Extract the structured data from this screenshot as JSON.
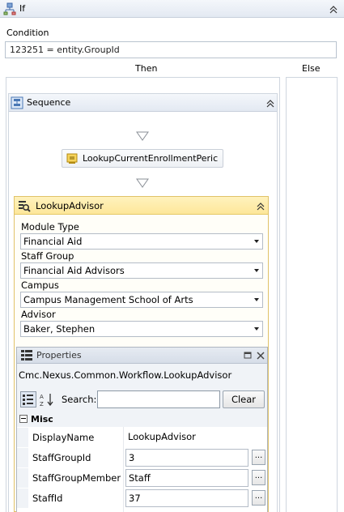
{
  "if_activity": {
    "title": "If"
  },
  "condition": {
    "label": "Condition",
    "value": "123251 = entity.GroupId"
  },
  "branches": {
    "then_label": "Then",
    "else_label": "Else"
  },
  "sequence": {
    "title": "Sequence"
  },
  "lookup_period": {
    "label": "LookupCurrentEnrollmentPeric"
  },
  "lookup_advisor": {
    "title": "LookupAdvisor",
    "fields": [
      {
        "label": "Module Type",
        "value": "Financial Aid"
      },
      {
        "label": "Staff Group",
        "value": "Financial Aid Advisors"
      },
      {
        "label": "Campus",
        "value": "Campus Management School of Arts"
      },
      {
        "label": "Advisor",
        "value": "Baker, Stephen"
      }
    ]
  },
  "properties": {
    "title": "Properties",
    "type_name": "Cmc.Nexus.Common.Workflow.LookupAdvisor",
    "search_label": "Search:",
    "search_value": "",
    "clear_label": "Clear",
    "category": "Misc",
    "rows": [
      {
        "name": "DisplayName",
        "value": "LookupAdvisor"
      },
      {
        "name": "StaffGroupId",
        "value": "3",
        "button": "..."
      },
      {
        "name": "StaffGroupMember",
        "value": "Staff",
        "button": "..."
      },
      {
        "name": "StaffId",
        "value": "37",
        "button": "..."
      }
    ]
  },
  "colors": {
    "activity_header": "#e3e9f2",
    "advisor_header": "#fde79a",
    "advisor_border": "#e0c268"
  }
}
